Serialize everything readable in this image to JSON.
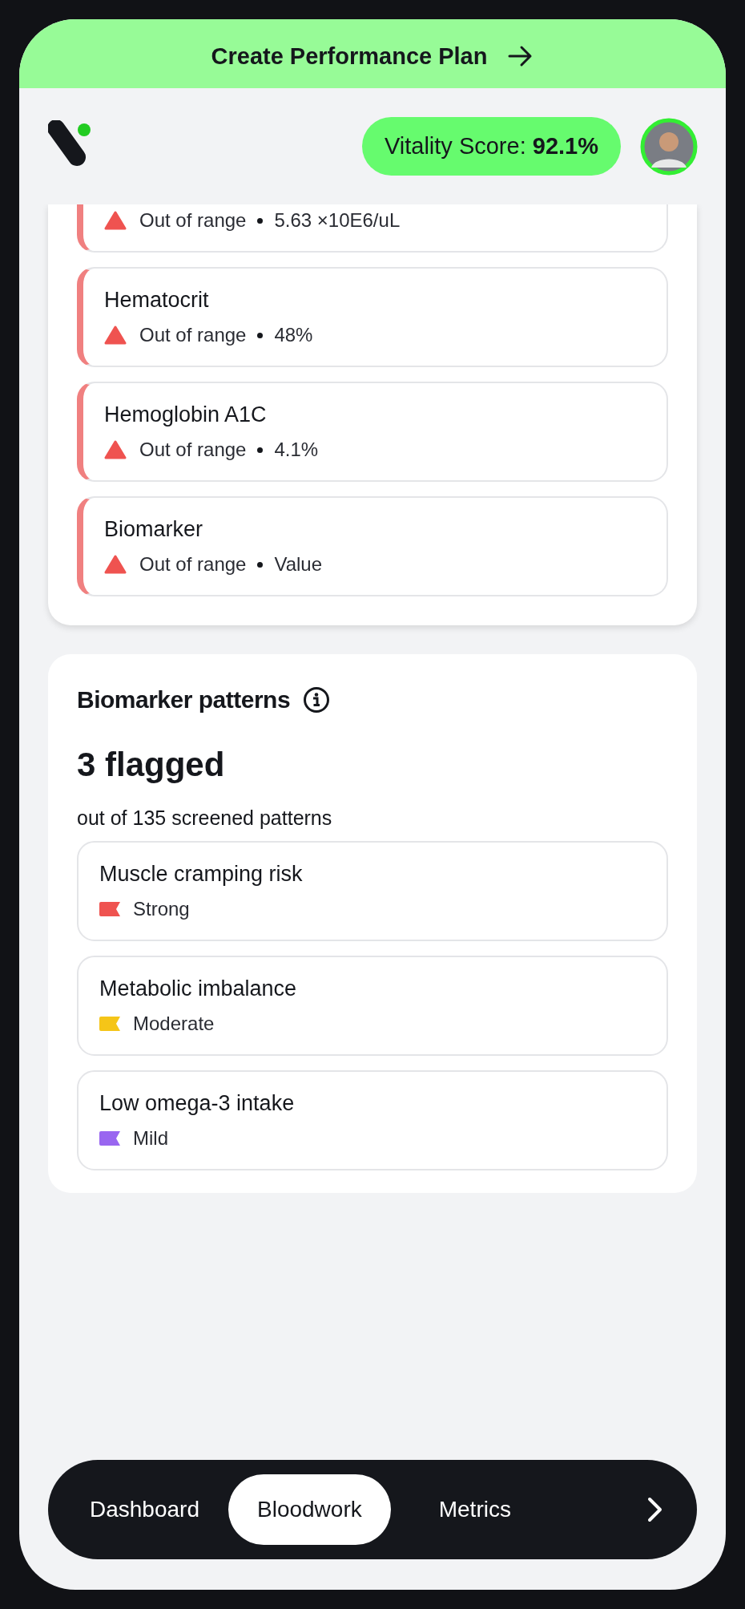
{
  "banner": {
    "label": "Create Performance Plan"
  },
  "header": {
    "score_label": "Vitality Score:",
    "score_value": "92.1%"
  },
  "biomarkers": [
    {
      "status": "Out of range",
      "value": "5.63 ×10E6/uL"
    },
    {
      "name": "Hematocrit",
      "status": "Out of range",
      "value": "48%"
    },
    {
      "name": "Hemoglobin A1C",
      "status": "Out of range",
      "value": "4.1%"
    },
    {
      "name": "Biomarker",
      "status": "Out of range",
      "value": "Value"
    }
  ],
  "patterns": {
    "title": "Biomarker patterns",
    "flagged": "3 flagged",
    "subtitle": "out of 135 screened patterns",
    "items": [
      {
        "name": "Muscle cramping risk",
        "severity": "Strong",
        "color": "#ef5350"
      },
      {
        "name": "Metabolic imbalance",
        "severity": "Moderate",
        "color": "#f5c518"
      },
      {
        "name": "Low omega-3 intake",
        "severity": "Mild",
        "color": "#9966f0"
      }
    ]
  },
  "nav": {
    "tabs": [
      {
        "label": "Dashboard",
        "selected": false
      },
      {
        "label": "Bloodwork",
        "selected": true
      },
      {
        "label": "Metrics",
        "selected": false
      }
    ]
  }
}
